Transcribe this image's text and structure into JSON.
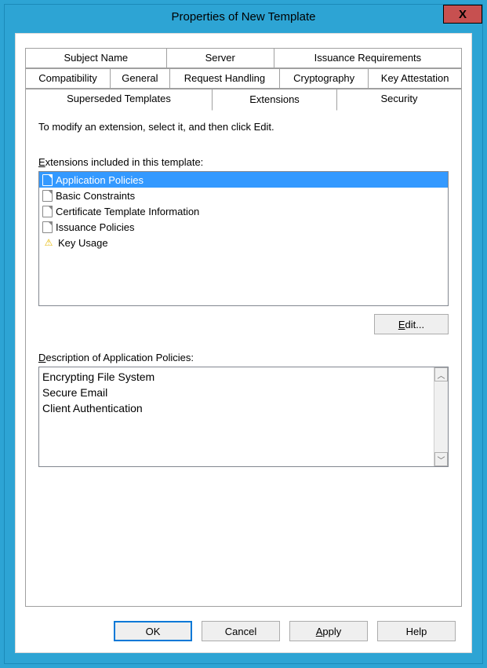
{
  "window": {
    "title": "Properties of New Template",
    "close": "X"
  },
  "tabs": {
    "row1": [
      "Subject Name",
      "Server",
      "Issuance Requirements"
    ],
    "row2": [
      "Compatibility",
      "General",
      "Request Handling",
      "Cryptography",
      "Key Attestation"
    ],
    "row3": [
      "Superseded Templates",
      "Extensions",
      "Security"
    ],
    "active": "Extensions"
  },
  "page": {
    "instruction": "To modify an extension, select it, and then click Edit.",
    "list_prefix": "E",
    "list_label_rest": "xtensions included in this template:",
    "items": [
      {
        "label": "Application Policies",
        "icon": "doc",
        "selected": true
      },
      {
        "label": "Basic Constraints",
        "icon": "doc",
        "selected": false
      },
      {
        "label": "Certificate Template Information",
        "icon": "doc",
        "selected": false
      },
      {
        "label": "Issuance Policies",
        "icon": "doc",
        "selected": false
      },
      {
        "label": "Key Usage",
        "icon": "warn",
        "selected": false
      }
    ],
    "edit_prefix": "E",
    "edit_rest": "dit...",
    "desc_prefix": "D",
    "desc_rest": "escription of Application Policies:",
    "description": "Encrypting File System\nSecure Email\nClient Authentication"
  },
  "buttons": {
    "ok": "OK",
    "cancel": "Cancel",
    "apply_prefix": "A",
    "apply_rest": "pply",
    "help": "Help"
  }
}
